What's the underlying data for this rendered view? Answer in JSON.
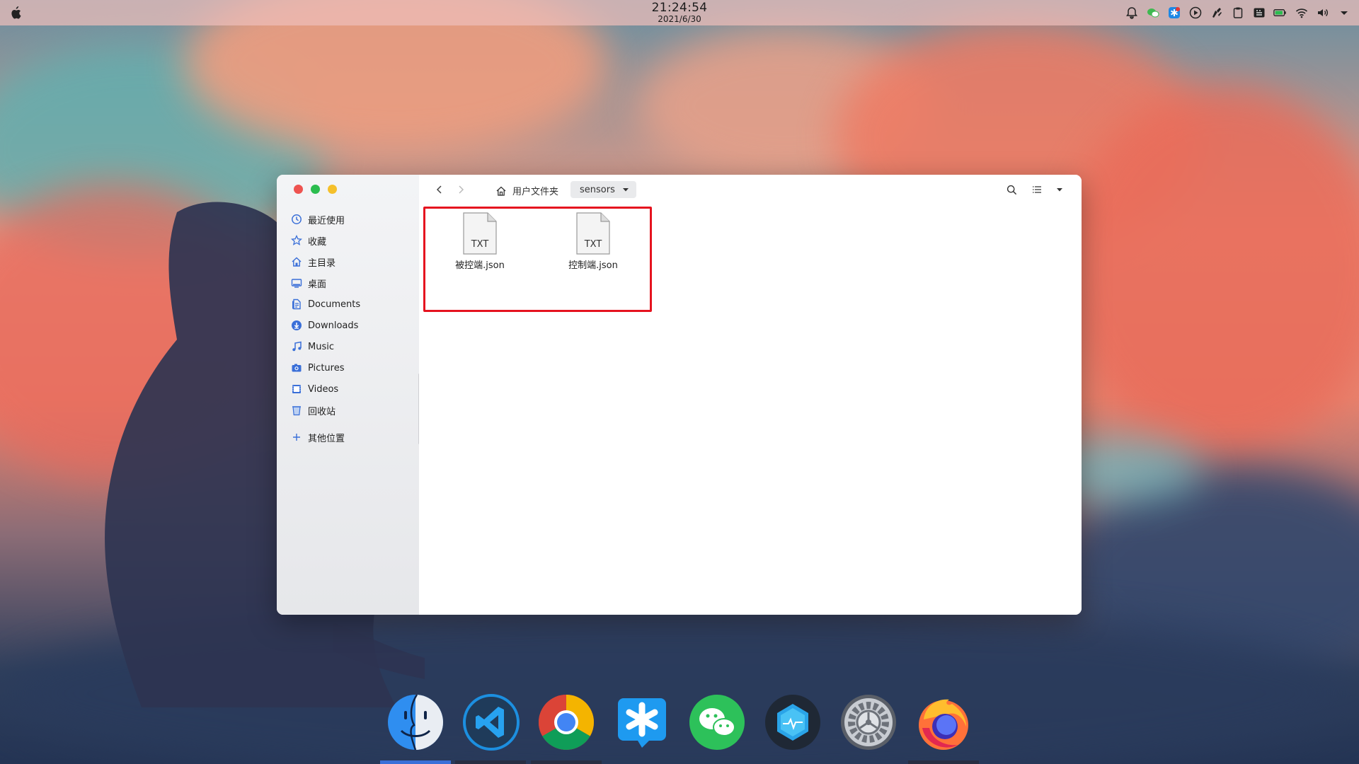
{
  "topbar": {
    "time": "21:24:54",
    "date": "2021/6/30",
    "tray_icons": [
      "bell-icon",
      "wechat-tray-icon",
      "app-tray-icon",
      "media-play-icon",
      "pen-icon",
      "clipboard-icon",
      "keyboard-icon",
      "battery-icon",
      "wifi-icon",
      "volume-icon",
      "chevron-down-icon"
    ]
  },
  "window": {
    "sidebar": {
      "items": [
        {
          "label": "最近使用",
          "icon": "recent-icon"
        },
        {
          "label": "收藏",
          "icon": "star-icon"
        },
        {
          "label": "主目录",
          "icon": "home-icon"
        },
        {
          "label": "桌面",
          "icon": "desktop-icon"
        },
        {
          "label": "Documents",
          "icon": "documents-icon"
        },
        {
          "label": "Downloads",
          "icon": "downloads-icon"
        },
        {
          "label": "Music",
          "icon": "music-icon"
        },
        {
          "label": "Pictures",
          "icon": "pictures-icon"
        },
        {
          "label": "Videos",
          "icon": "videos-icon"
        },
        {
          "label": "回收站",
          "icon": "trash-icon"
        }
      ],
      "other": {
        "label": "其他位置",
        "icon": "plus-icon"
      }
    },
    "toolbar": {
      "home_label": "用户文件夹",
      "current_folder": "sensors"
    },
    "files": [
      {
        "name": "被控端.json",
        "type_label": "TXT"
      },
      {
        "name": "控制端.json",
        "type_label": "TXT"
      }
    ]
  },
  "dock": {
    "apps": [
      "finder",
      "vscode",
      "chrome",
      "app-asterisk",
      "wechat",
      "monitor",
      "settings",
      "firefox"
    ]
  },
  "colors": {
    "highlight": "#e5131f",
    "close": "#ee5350",
    "minimize": "#2bbd4f",
    "maximize": "#f5c02b",
    "accent": "#3a6fd8"
  }
}
